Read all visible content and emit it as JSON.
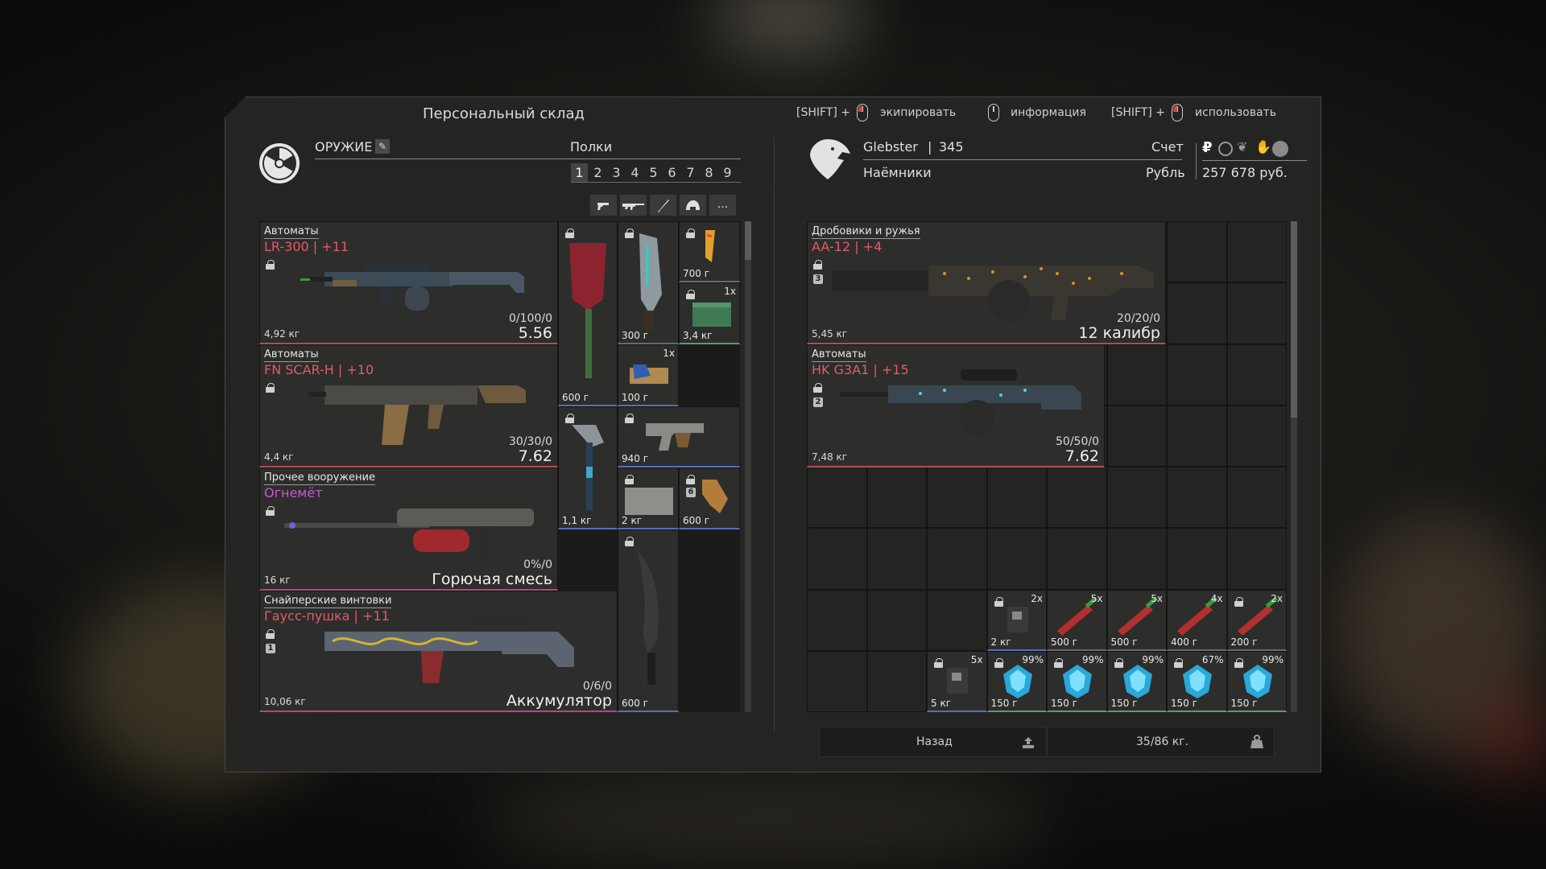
{
  "header": {
    "title": "Персональный склад",
    "hints": [
      {
        "prefix": "[SHIFT] +",
        "label": "экипировать"
      },
      {
        "prefix": "",
        "label": "информация"
      },
      {
        "prefix": "[SHIFT] +",
        "label": "использовать"
      }
    ]
  },
  "left": {
    "section": "ОРУЖИЕ",
    "shelves_label": "Полки",
    "shelves": [
      "1",
      "2",
      "3",
      "4",
      "5",
      "6",
      "7",
      "8",
      "9"
    ],
    "active_shelf": "1",
    "filters": [
      "pistol-icon",
      "rifle-icon",
      "knife-icon",
      "helmet-icon",
      "more-icon"
    ],
    "more_label": "...",
    "weapons": [
      {
        "category": "Автоматы",
        "name": "LR-300 | +11",
        "weight": "4,92 кг",
        "ammo": "0/100/0",
        "caliber": "5.56"
      },
      {
        "category": "Автоматы",
        "name": "FN SCAR-H | +10",
        "weight": "4,4 кг",
        "ammo": "30/30/0",
        "caliber": "7.62"
      },
      {
        "category": "Прочее вооружение",
        "name": "Огнемёт",
        "weight": "16 кг",
        "ammo": "0%/0",
        "caliber": "Горючая смесь"
      },
      {
        "category": "Снайперские винтовки",
        "name": "Гаусс-пушка | +11",
        "weight": "10,06 кг",
        "ammo": "0/6/0",
        "caliber": "Аккумулятор"
      }
    ],
    "items": [
      {
        "weight": "600 г",
        "qty": ""
      },
      {
        "weight": "300 г",
        "qty": ""
      },
      {
        "weight": "700 г",
        "qty": ""
      },
      {
        "weight": "3,4 кг",
        "qty": "1x"
      },
      {
        "weight": "100 г",
        "qty": "1x"
      },
      {
        "weight": "940 г",
        "qty": ""
      },
      {
        "weight": "1,1 кг",
        "qty": ""
      },
      {
        "weight": "2 кг",
        "qty": ""
      },
      {
        "weight": "600 г",
        "qty": ""
      },
      {
        "weight": "600 г",
        "qty": ""
      }
    ]
  },
  "right": {
    "player": "Glebster",
    "level": "345",
    "faction": "Наёмники",
    "account_label": "Счет",
    "currency": "Рубль",
    "money": "257 678 руб.",
    "currency_icons": [
      "ruble-icon",
      "gear-currency-icon",
      "leaf-icon",
      "hand-icon",
      "coin-icon"
    ],
    "weapons": [
      {
        "category": "Дробовики и ружья",
        "name": "AA-12 | +4",
        "weight": "5,45 кг",
        "ammo": "20/20/0",
        "caliber": "12 калибр"
      },
      {
        "category": "Автоматы",
        "name": "HK G3A1 | +15",
        "weight": "7,48 кг",
        "ammo": "50/50/0",
        "caliber": "7.62"
      }
    ],
    "items": [
      {
        "qty": "2x",
        "weight": "2 кг",
        "kind": "device"
      },
      {
        "qty": "5x",
        "weight": "500 г",
        "kind": "syringe"
      },
      {
        "qty": "5x",
        "weight": "500 г",
        "kind": "syringe"
      },
      {
        "qty": "4x",
        "weight": "400 г",
        "kind": "syringe"
      },
      {
        "qty": "2x",
        "weight": "200 г",
        "kind": "syringe"
      },
      {
        "qty": "5x",
        "weight": "5 кг",
        "kind": "device"
      },
      {
        "pct": "99%",
        "weight": "150 г",
        "kind": "crystal"
      },
      {
        "pct": "99%",
        "weight": "150 г",
        "kind": "crystal"
      },
      {
        "pct": "99%",
        "weight": "150 г",
        "kind": "crystal"
      },
      {
        "pct": "67%",
        "weight": "150 г",
        "kind": "crystal"
      },
      {
        "pct": "99%",
        "weight": "150 г",
        "kind": "crystal"
      }
    ],
    "back_label": "Назад",
    "capacity": "35/86 кг."
  }
}
